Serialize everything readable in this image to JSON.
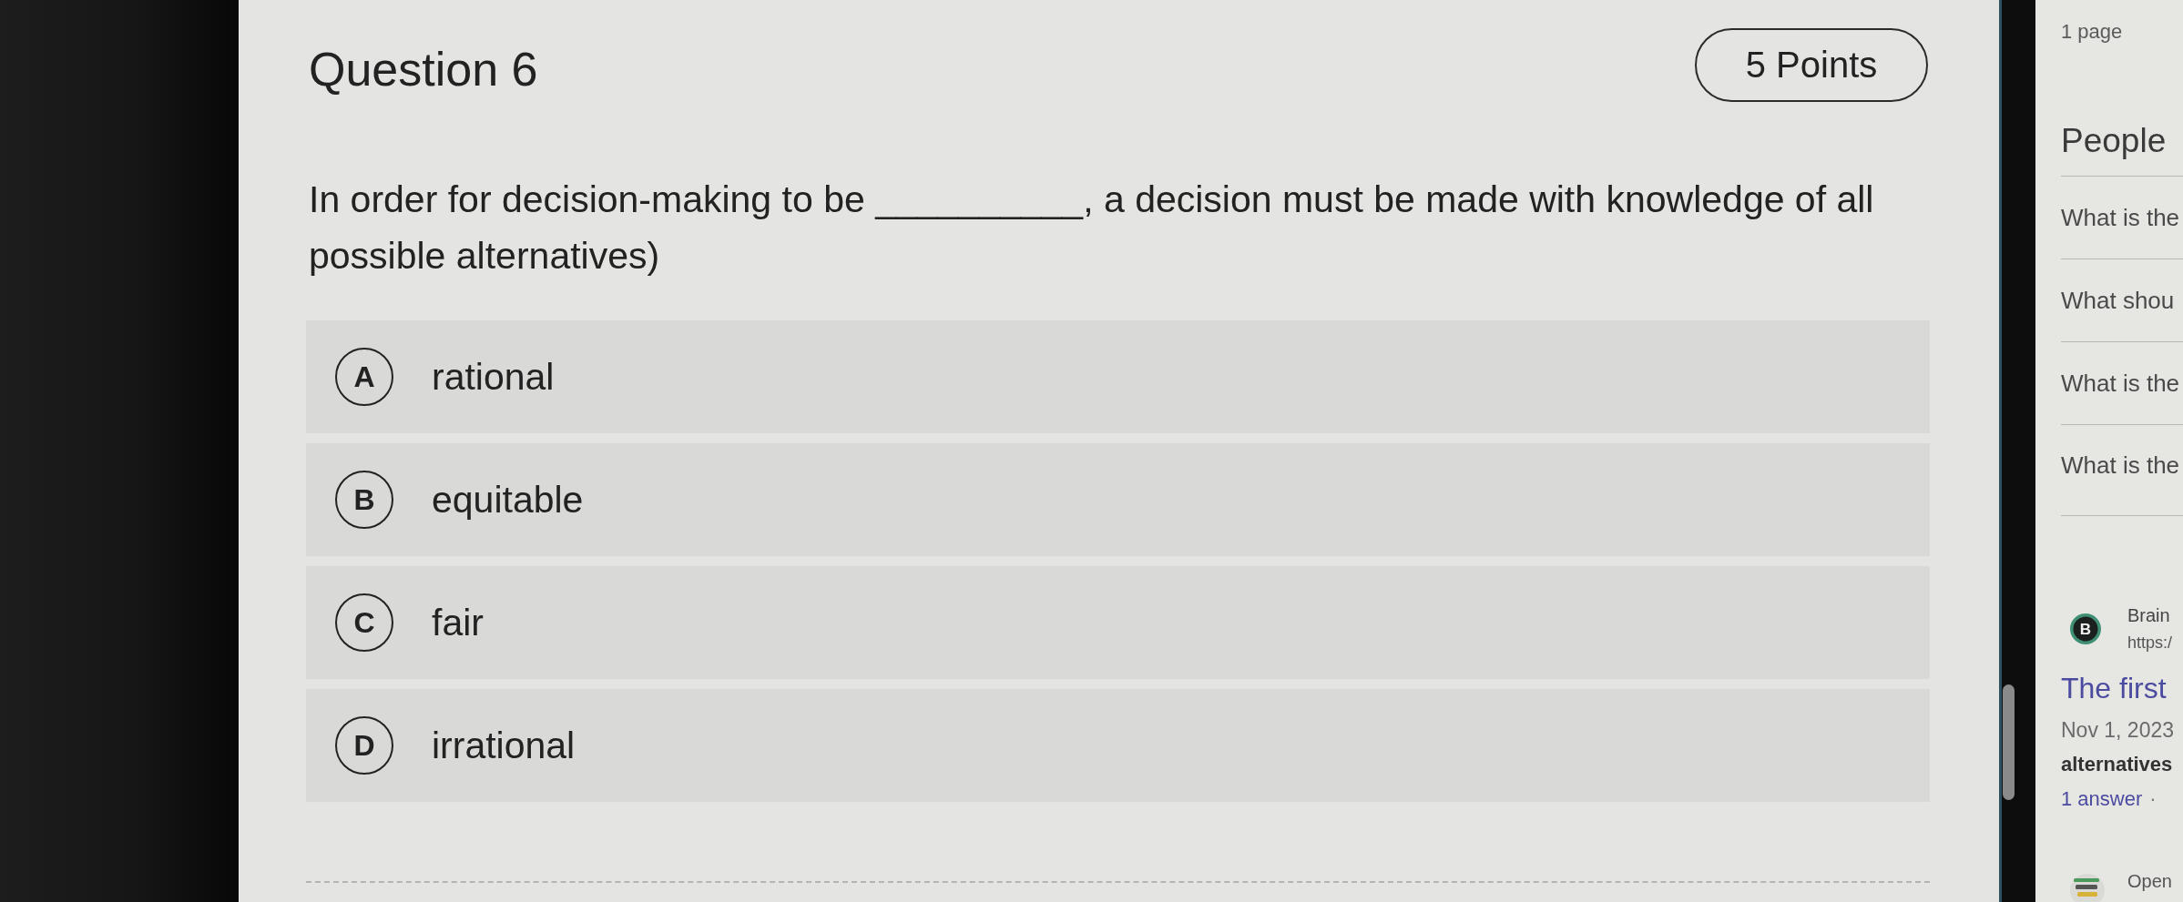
{
  "question": {
    "title": "Question 6",
    "points": "5 Points",
    "text": "In order for decision-making to be __________, a decision must be made with knowledge of all possible alternatives)"
  },
  "options": [
    {
      "letter": "A",
      "label": "rational",
      "selected": false
    },
    {
      "letter": "B",
      "label": "equitable",
      "selected": false
    },
    {
      "letter": "C",
      "label": "fair",
      "selected": false
    },
    {
      "letter": "D",
      "label": "irrational",
      "selected": false
    }
  ],
  "side_panel": {
    "page_count": "1 page",
    "related": {
      "heading": "People",
      "questions": [
        "What is the",
        "What shou",
        "What is the",
        "What is the"
      ]
    },
    "result": {
      "logo_letter": "B",
      "site": "Brain",
      "url": "https:/",
      "title": "The first",
      "date": "Nov 1, 2023",
      "snippet": "alternatives",
      "answers": "1 answer",
      "separator": "·"
    },
    "next_result": {
      "site": "Open"
    }
  }
}
